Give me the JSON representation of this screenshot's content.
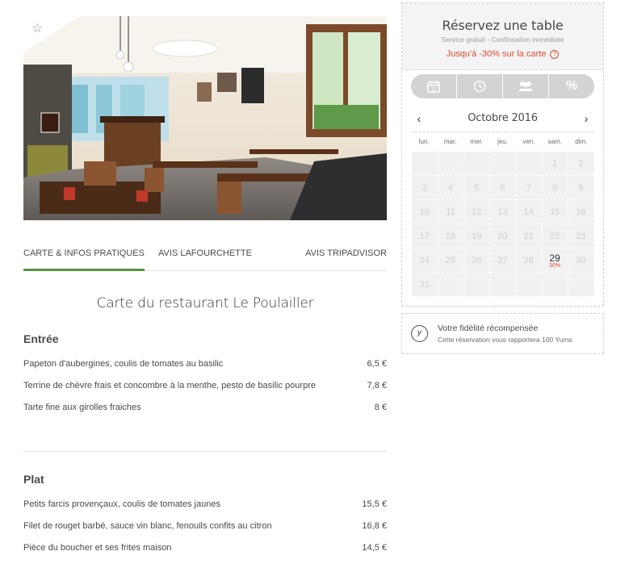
{
  "restaurant": {
    "favorite_icon": "star-outline-icon"
  },
  "tabs": [
    {
      "label": "CARTE & INFOS PRATIQUES",
      "active": true
    },
    {
      "label": "AVIS LAFOURCHETTE",
      "active": false
    },
    {
      "label": "AVIS TRIPADVISOR",
      "active": false
    }
  ],
  "menu": {
    "title": "Carte du restaurant Le Poulailler",
    "sections": [
      {
        "name": "Entrée",
        "dishes": [
          {
            "name": "Papeton d'aubergines, coulis de tomates au basilic",
            "price": "6,5 €"
          },
          {
            "name": "Terrine de chèvre frais et concombre à la menthe, pesto de basilic pourpre",
            "price": "7,8 €"
          },
          {
            "name": "Tarte fine aux girolles fraiches",
            "price": "8 €"
          }
        ]
      },
      {
        "name": "Plat",
        "dishes": [
          {
            "name": "Petits farcis provençaux, coulis de tomates jaunes",
            "price": "15,5 €"
          },
          {
            "name": "Filet de rouget barbé, sauce vin blanc, fenouils confits au citron",
            "price": "16,8 €"
          },
          {
            "name": "Pièce du boucher et ses frites maison",
            "price": "14,5 €"
          }
        ]
      }
    ]
  },
  "booking": {
    "title": "Réservez une table",
    "subtitle": "Service gratuit - Confirmation immédiate",
    "promo": "Jusqu'à -30% sur la carte",
    "promo_help_icon": "question-circle-icon",
    "steps": [
      {
        "icon": "calendar-icon"
      },
      {
        "icon": "clock-icon"
      },
      {
        "icon": "people-icon"
      },
      {
        "icon": "percent-icon",
        "label": "%"
      }
    ],
    "calendar": {
      "month": "Octobre 2016",
      "prev_icon": "chevron-left-icon",
      "next_icon": "chevron-right-icon",
      "weekdays": [
        "lun.",
        "mar.",
        "mer.",
        "jeu.",
        "ven.",
        "sam.",
        "dim."
      ],
      "leading_empty": 5,
      "days_in_month": 31,
      "available": [
        {
          "day": 29,
          "promo": "30%"
        }
      ]
    }
  },
  "loyalty": {
    "icon": "yums-icon",
    "icon_letter": "y",
    "title": "Votre fidélité récompensée",
    "subtitle": "Cette réservation vous rapportera 100 Yums"
  },
  "colors": {
    "accent_green": "#589442",
    "promo_red": "#e04a2b"
  }
}
